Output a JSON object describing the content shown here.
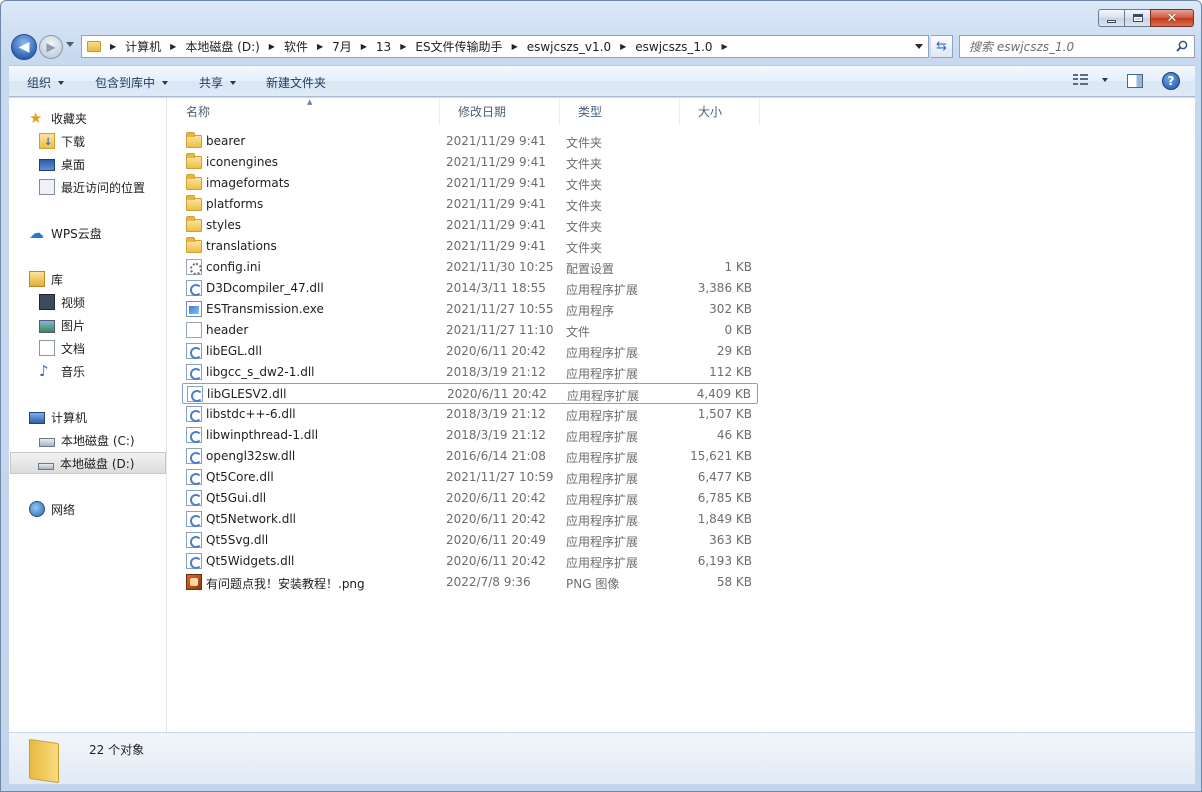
{
  "window": {
    "caption_buttons": {
      "minimize": "minimize",
      "maximize": "maximize",
      "close": "close"
    }
  },
  "address": {
    "crumbs": [
      "计算机",
      "本地磁盘 (D:)",
      "软件",
      "7月",
      "13",
      "ES文件传输助手",
      "eswjcszs_v1.0",
      "eswjcszs_1.0"
    ]
  },
  "search": {
    "placeholder": "搜索 eswjcszs_1.0"
  },
  "toolbar": {
    "organize": "组织",
    "include_in_library": "包含到库中",
    "share": "共享",
    "new_folder": "新建文件夹"
  },
  "nav": {
    "favorites": {
      "label": "收藏夹",
      "items": [
        "下载",
        "桌面",
        "最近访问的位置"
      ]
    },
    "wps": {
      "label": "WPS云盘"
    },
    "libraries": {
      "label": "库",
      "items": [
        "视频",
        "图片",
        "文档",
        "音乐"
      ]
    },
    "computer": {
      "label": "计算机",
      "items": [
        "本地磁盘 (C:)",
        "本地磁盘 (D:)"
      ],
      "selected": "本地磁盘 (D:)"
    },
    "network": {
      "label": "网络"
    }
  },
  "columns": {
    "name": "名称",
    "date": "修改日期",
    "type": "类型",
    "size": "大小"
  },
  "files": [
    {
      "name": "bearer",
      "date": "2021/11/29 9:41",
      "type": "文件夹",
      "size": "",
      "icon": "folder-icon"
    },
    {
      "name": "iconengines",
      "date": "2021/11/29 9:41",
      "type": "文件夹",
      "size": "",
      "icon": "folder-icon"
    },
    {
      "name": "imageformats",
      "date": "2021/11/29 9:41",
      "type": "文件夹",
      "size": "",
      "icon": "folder-icon"
    },
    {
      "name": "platforms",
      "date": "2021/11/29 9:41",
      "type": "文件夹",
      "size": "",
      "icon": "folder-icon"
    },
    {
      "name": "styles",
      "date": "2021/11/29 9:41",
      "type": "文件夹",
      "size": "",
      "icon": "folder-icon"
    },
    {
      "name": "translations",
      "date": "2021/11/29 9:41",
      "type": "文件夹",
      "size": "",
      "icon": "folder-icon"
    },
    {
      "name": "config.ini",
      "date": "2021/11/30 10:25",
      "type": "配置设置",
      "size": "1 KB",
      "icon": "settings-file-icon"
    },
    {
      "name": "D3Dcompiler_47.dll",
      "date": "2014/3/11 18:55",
      "type": "应用程序扩展",
      "size": "3,386 KB",
      "icon": "dll-file-icon"
    },
    {
      "name": "ESTransmission.exe",
      "date": "2021/11/27 10:55",
      "type": "应用程序",
      "size": "302 KB",
      "icon": "exe-file-icon"
    },
    {
      "name": "header",
      "date": "2021/11/27 11:10",
      "type": "文件",
      "size": "0 KB",
      "icon": "blank-file-icon"
    },
    {
      "name": "libEGL.dll",
      "date": "2020/6/11 20:42",
      "type": "应用程序扩展",
      "size": "29 KB",
      "icon": "dll-file-icon"
    },
    {
      "name": "libgcc_s_dw2-1.dll",
      "date": "2018/3/19 21:12",
      "type": "应用程序扩展",
      "size": "112 KB",
      "icon": "dll-file-icon"
    },
    {
      "name": "libGLESV2.dll",
      "date": "2020/6/11 20:42",
      "type": "应用程序扩展",
      "size": "4,409 KB",
      "icon": "dll-file-icon"
    },
    {
      "name": "libstdc++-6.dll",
      "date": "2018/3/19 21:12",
      "type": "应用程序扩展",
      "size": "1,507 KB",
      "icon": "dll-file-icon"
    },
    {
      "name": "libwinpthread-1.dll",
      "date": "2018/3/19 21:12",
      "type": "应用程序扩展",
      "size": "46 KB",
      "icon": "dll-file-icon"
    },
    {
      "name": "opengl32sw.dll",
      "date": "2016/6/14 21:08",
      "type": "应用程序扩展",
      "size": "15,621 KB",
      "icon": "dll-file-icon"
    },
    {
      "name": "Qt5Core.dll",
      "date": "2021/11/27 10:59",
      "type": "应用程序扩展",
      "size": "6,477 KB",
      "icon": "dll-file-icon"
    },
    {
      "name": "Qt5Gui.dll",
      "date": "2020/6/11 20:42",
      "type": "应用程序扩展",
      "size": "6,785 KB",
      "icon": "dll-file-icon"
    },
    {
      "name": "Qt5Network.dll",
      "date": "2020/6/11 20:42",
      "type": "应用程序扩展",
      "size": "1,849 KB",
      "icon": "dll-file-icon"
    },
    {
      "name": "Qt5Svg.dll",
      "date": "2020/6/11 20:49",
      "type": "应用程序扩展",
      "size": "363 KB",
      "icon": "dll-file-icon"
    },
    {
      "name": "Qt5Widgets.dll",
      "date": "2020/6/11 20:42",
      "type": "应用程序扩展",
      "size": "6,193 KB",
      "icon": "dll-file-icon"
    },
    {
      "name": "有问题点我！安装教程！.png",
      "date": "2022/7/8 9:36",
      "type": "PNG 图像",
      "size": "58 KB",
      "icon": "png-file-icon"
    }
  ],
  "focused_file": "libGLESV2.dll",
  "status": {
    "count": "22 个对象"
  }
}
